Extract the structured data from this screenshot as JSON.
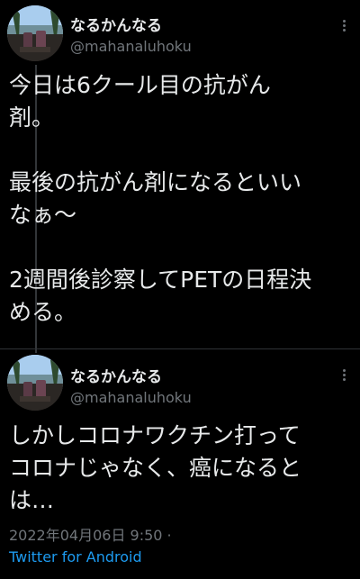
{
  "tweets": [
    {
      "author_name": "なるかんなる",
      "author_handle": "@mahanaluhoku",
      "text": "今日は6クール目の抗がん\n剤。\n\n最後の抗がん剤になるといい\nなぁ〜\n\n2週間後診察してPETの日程決\nめる。"
    },
    {
      "author_name": "なるかんなる",
      "author_handle": "@mahanaluhoku",
      "text": "しかしコロナワクチン打って\nコロナじゃなく、癌になると\nは…",
      "timestamp": "2022年04月06日 9:50 ·",
      "source": "Twitter for Android"
    }
  ],
  "colors": {
    "background": "#000000",
    "text_primary": "#e7e9ea",
    "text_secondary": "#71767b",
    "link": "#1d9bf0",
    "divider": "#2f3336"
  },
  "icons": {
    "more": "more-vertical-icon"
  }
}
